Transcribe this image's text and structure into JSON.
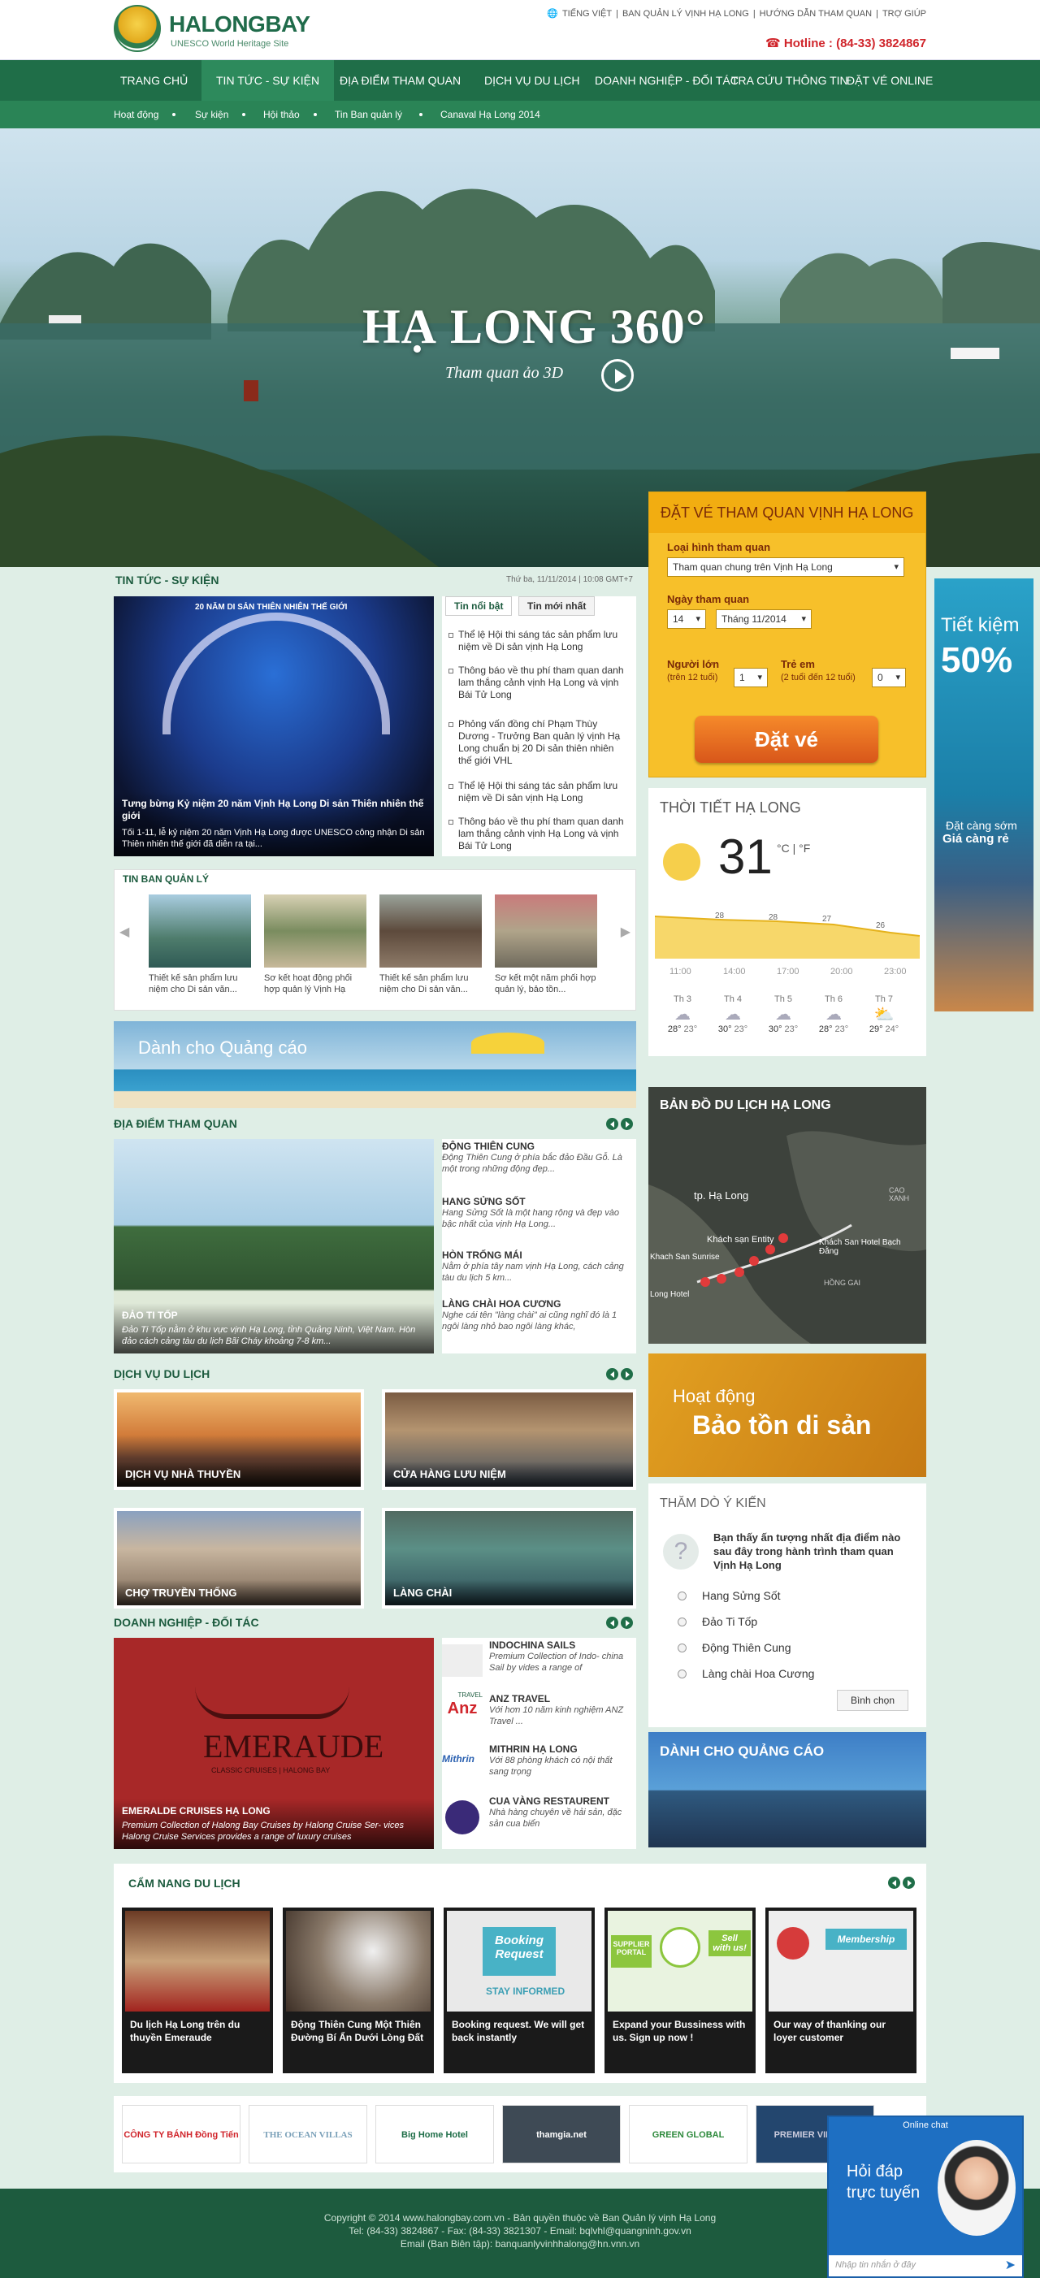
{
  "header": {
    "logo_name": "HALONGBAY",
    "logo_sub": "UNESCO World Heritage Site",
    "top_links": [
      "TIẾNG VIỆT",
      "BAN QUẢN LÝ VỊNH HẠ LONG",
      "HƯỚNG DẪN THAM QUAN",
      "TRỢ GIÚP"
    ],
    "hotline_label": "Hotline :",
    "hotline_number": "(84-33) 3824867"
  },
  "nav": {
    "items": [
      "TRANG CHỦ",
      "TIN TỨC - SỰ KIỆN",
      "ĐỊA ĐIỂM THAM QUAN",
      "DỊCH VỤ DU LỊCH",
      "DOANH NGHIỆP - ĐỐI TÁC",
      "TRA CỨU THÔNG TIN",
      "ĐẶT VÉ ONLINE"
    ],
    "sub_items": [
      "Hoạt động",
      "Sự kiện",
      "Hội thảo",
      "Tin Ban quản lý",
      "Canaval Hạ Long 2014"
    ]
  },
  "hero": {
    "title": "HẠ LONG 360°",
    "subtitle": "Tham quan ảo 3D"
  },
  "booking": {
    "title": "ĐẶT VÉ THAM QUAN VỊNH HẠ LONG",
    "type_label": "Loại hình tham quan",
    "type_value": "Tham quan chung trên Vịnh Hạ Long",
    "date_label": "Ngày tham quan",
    "day_value": "14",
    "month_value": "Tháng 11/2014",
    "adult_label": "Người lớn",
    "adult_note": "(trên 12 tuổi)",
    "adult_value": "1",
    "child_label": "Trẻ em",
    "child_note": "(2 tuổi đến 12 tuổi)",
    "child_value": "0",
    "button": "Đặt vé"
  },
  "news": {
    "title": "TIN TỨC - SỰ KIỆN",
    "date": "Thứ ba, 11/11/2014 | 10:08 GMT+7",
    "feature_title": "Tưng bừng Kỷ niệm 20 năm Vịnh Hạ Long Di sản Thiên nhiên thế giới",
    "feature_desc": "Tối 1-11, lễ kỷ niệm 20 năm Vịnh Hạ Long được UNESCO công nhận Di sản Thiên nhiên thế giới đã diễn ra tại...",
    "feature_banner": "20 NĂM DI SẢN THIÊN NHIÊN THẾ GIỚI",
    "tab_hot": "Tin nổi bật",
    "tab_new": "Tin mới nhất",
    "items": [
      "Thể lệ Hội thi sáng tác sản phẩm lưu niệm về Di sản vịnh Hạ Long",
      "Thông báo về thu phí tham quan danh lam thắng cảnh vịnh Hạ Long và vịnh Bái Tử Long",
      "Phỏng vấn đồng chí Phạm Thùy Dương - Trưởng Ban quản lý vịnh Hạ Long chuẩn bị  20 Di sản thiên nhiên thế giới VHL",
      "Thể lệ Hội thi sáng tác sản phẩm lưu niệm về Di sản vịnh Hạ Long",
      "Thông báo về thu phí tham quan danh lam thắng cảnh vịnh Hạ Long và vịnh Bái Tử Long"
    ],
    "mgmt_title": "TIN BAN QUẢN LÝ",
    "mgmt_items": [
      "Thiết kế sản phẩm lưu niệm cho Di sản văn...",
      "Sơ kết hoạt động phối hợp quản lý Vịnh Hạ",
      "Thiết kế sản phẩm lưu niệm cho Di sản văn...",
      "Sơ kết một năm phối hợp quản lý, bảo tồn..."
    ]
  },
  "ad_banner": "Dành cho Quảng cáo",
  "places": {
    "title": "ĐỊA ĐIỂM THAM QUAN",
    "feature_title": "ĐẢO TI TỐP",
    "feature_desc": "Đảo Ti Tốp nằm ở khu vực vịnh Hạ Long, tỉnh Quảng Ninh, Việt Nam. Hòn đảo cách cảng tàu du lịch Bãi Cháy khoảng 7-8 km...",
    "items": [
      {
        "title": "ĐỘNG THIÊN CUNG",
        "desc": "Động Thiên Cung ở phía bắc đảo Đầu Gỗ. Là một trong những động đẹp..."
      },
      {
        "title": "HANG SỬNG SỐT",
        "desc": "Hang Sửng Sốt là một hang rộng và đẹp vào bậc nhất của vịnh Hạ Long..."
      },
      {
        "title": "HÒN TRỐNG MÁI",
        "desc": "Nằm ở phía tây nam vịnh Hạ Long, cách cảng tàu du lịch 5 km..."
      },
      {
        "title": "LÀNG CHÀI HOA CƯƠNG",
        "desc": "Nghe cái tên \"làng chài\" ai cũng nghĩ đó là 1 ngôi làng nhỏ bao ngôi làng khác,"
      }
    ]
  },
  "services": {
    "title": "DỊCH VỤ DU LỊCH",
    "items": [
      "DỊCH VỤ NHÀ THUYỀN",
      "CỬA HÀNG LƯU NIỆM",
      "CHỢ TRUYỀN THỐNG",
      "LÀNG CHÀI"
    ]
  },
  "partners_section": {
    "title": "DOANH NGHIỆP - ĐỐI TÁC",
    "feature_brand": "EMERAUDE",
    "feature_brand_sub": "CLASSIC CRUISES | HALONG BAY",
    "feature_title": "EMERALDE CRUISES HẠ LONG",
    "feature_desc": "Premium Collection of Halong Bay Cruises by Halong Cruise Ser- vices  Halong Cruise Services provides a range of luxury cruises",
    "items": [
      {
        "title": "INDOCHINA SAILS",
        "desc": "Premium Collection of Indo- china Sail by vides a range of"
      },
      {
        "title": "ANZ TRAVEL",
        "desc": "Với hơn 10 năm kinh nghiệm ANZ Travel ..."
      },
      {
        "title": "MITHRIN HẠ LONG",
        "desc": "Với 88 phòng khách có nội thất sang trọng"
      },
      {
        "title": "CUA VÀNG RESTAURENT",
        "desc": "Nhà hàng chuyên về hải sản, đặc sản cua biển"
      }
    ],
    "logo_anz": "Anz",
    "logo_anz_tag": "TRAVEL",
    "logo_mithrin": "Mithrin"
  },
  "weather": {
    "title": "THỜI TIẾT HẠ LONG",
    "temp": "31",
    "units": "°C | °F",
    "chart_points": [
      "28",
      "28",
      "27",
      "26"
    ],
    "times": [
      "11:00",
      "14:00",
      "17:00",
      "20:00",
      "23:00"
    ],
    "days": [
      {
        "name": "Th 3",
        "hi": "28°",
        "lo": "23°"
      },
      {
        "name": "Th 4",
        "hi": "30°",
        "lo": "23°"
      },
      {
        "name": "Th 5",
        "hi": "30°",
        "lo": "23°"
      },
      {
        "name": "Th 6",
        "hi": "28°",
        "lo": "23°"
      },
      {
        "name": "Th 7",
        "hi": "29°",
        "lo": "24°"
      }
    ]
  },
  "map": {
    "title": "BẢN ĐỒ DU LỊCH HẠ LONG",
    "labels": [
      "tp. Hạ Long",
      "Khách sạn Entity",
      "Khách San Hotel Bạch Đằng",
      "Khach San Sunrise",
      "HỒNG GAI",
      "CAO XANH",
      "Long Hotel"
    ]
  },
  "heritage": {
    "line1": "Hoạt động",
    "line2": "Bảo tồn di sản"
  },
  "poll": {
    "title": "THĂM DÒ Ý KIẾN",
    "question": "Bạn thấy ấn tượng nhất địa điểm nào sau đây trong hành trình tham quan Vịnh Hạ Long",
    "options": [
      "Hang Sửng Sốt",
      "Đảo Ti Tốp",
      "Động Thiên Cung",
      "Làng chài Hoa Cương"
    ],
    "button": "Bình chọn"
  },
  "side_ad": {
    "title": "DÀNH CHO QUẢNG CÁO"
  },
  "promo": {
    "line1": "Tiết kiệm",
    "line2": "50%",
    "line3": "Đặt càng sớm",
    "line4": "Giá càng rẻ"
  },
  "guide": {
    "title": "CẨM NANG DU LỊCH",
    "items": [
      "Du lịch Hạ Long trên du thuyền Emeraude",
      "Động Thiên Cung Một Thiên Đường Bí Ẩn Dưới Lòng Đất",
      "Booking request. We will get back instantly",
      "Expand your Bussiness with us. Sign up now !",
      "Our way of thanking our loyer customer"
    ],
    "booking_img": "Booking Request",
    "booking_img2": "STAY INFORMED",
    "supplier_img": "SUPPLIER PORTAL",
    "sell_img": "Sell with us!",
    "member_img": "Membership"
  },
  "partners": [
    "CÔNG TY BÁNH Đồng Tiến",
    "THE OCEAN VILLAS",
    "Big Home Hotel",
    "thamgia.net",
    "GREEN GLOBAL",
    "PREMIER VILLAGE"
  ],
  "chat": {
    "title": "Online chat",
    "line1": "Hỏi đáp",
    "line2": "trực tuyến",
    "placeholder": "Nhập tin nhắn ở đây"
  },
  "footer": {
    "line1": "Copyright © 2014 www.halongbay.com.vn - Bản quyền thuộc về Ban Quản lý vịnh Hạ Long",
    "line2": "Tel: (84-33) 3824867 - Fax: (84-33) 3821307 - Email: bqlvhl@quangninh.gov.vn",
    "line3": "Email (Ban Biên tập): banquanlyvinhhalong@hn.vnn.vn"
  }
}
